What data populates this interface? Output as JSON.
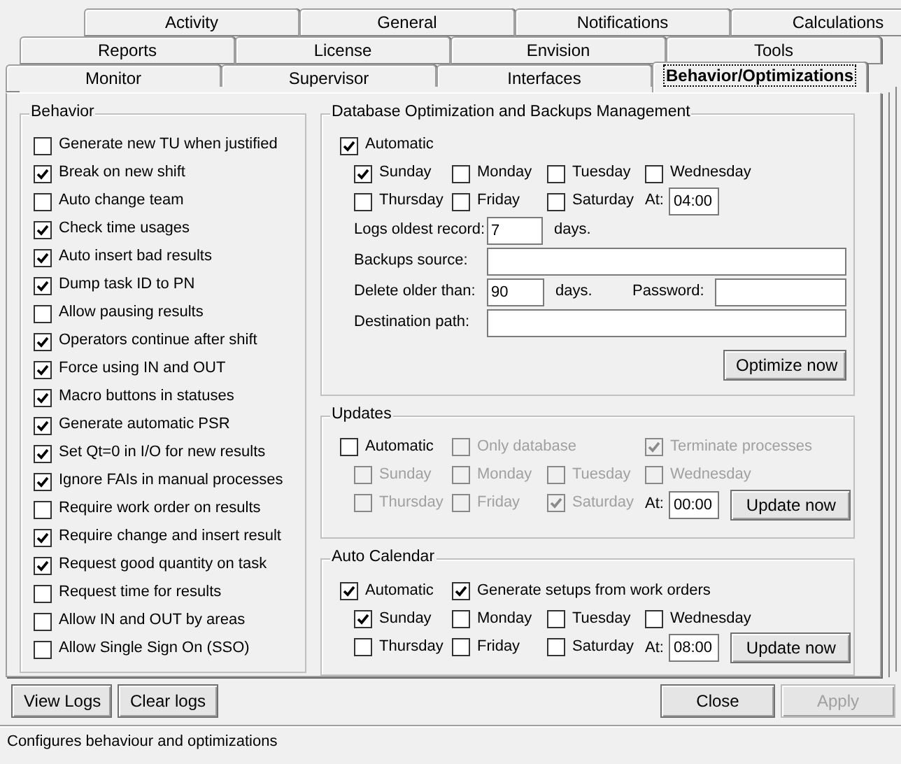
{
  "tab_rows": [
    {
      "tabs": [
        {
          "label": "Activity",
          "selected": false
        },
        {
          "label": "General",
          "selected": false
        },
        {
          "label": "Notifications",
          "selected": false
        },
        {
          "label": "Calculations",
          "selected": false
        }
      ]
    },
    {
      "tabs": [
        {
          "label": "Reports",
          "selected": false
        },
        {
          "label": "License",
          "selected": false
        },
        {
          "label": "Envision",
          "selected": false
        },
        {
          "label": "Tools",
          "selected": false
        }
      ]
    },
    {
      "tabs": [
        {
          "label": "Monitor",
          "selected": false
        },
        {
          "label": "Supervisor",
          "selected": false
        },
        {
          "label": "Interfaces",
          "selected": false
        },
        {
          "label": "Behavior/Optimizations",
          "selected": true
        }
      ]
    }
  ],
  "behavior": {
    "title": "Behavior",
    "items": [
      {
        "label": "Generate new TU when justified",
        "checked": false
      },
      {
        "label": "Break on new shift",
        "checked": true
      },
      {
        "label": "Auto change team",
        "checked": false
      },
      {
        "label": "Check time usages",
        "checked": true
      },
      {
        "label": "Auto insert bad results",
        "checked": true
      },
      {
        "label": "Dump task ID to PN",
        "checked": true
      },
      {
        "label": "Allow pausing results",
        "checked": false
      },
      {
        "label": "Operators continue after shift",
        "checked": true
      },
      {
        "label": "Force using IN and OUT",
        "checked": true
      },
      {
        "label": "Macro buttons in statuses",
        "checked": true
      },
      {
        "label": "Generate automatic PSR",
        "checked": true
      },
      {
        "label": "Set Qt=0 in I/O for new results",
        "checked": true
      },
      {
        "label": "Ignore FAIs in manual processes",
        "checked": true
      },
      {
        "label": "Require work order on results",
        "checked": false
      },
      {
        "label": "Require change and insert result",
        "checked": true
      },
      {
        "label": "Request good quantity on task",
        "checked": true
      },
      {
        "label": "Request time for results",
        "checked": false
      },
      {
        "label": "Allow IN and OUT by areas",
        "checked": false
      },
      {
        "label": "Allow Single Sign On (SSO)",
        "checked": false
      }
    ]
  },
  "database": {
    "title": "Database Optimization and Backups Management",
    "options": [
      {
        "label": "Automatic",
        "checked": true,
        "disabled": false
      }
    ],
    "days": [
      {
        "label": "Sunday",
        "checked": true,
        "disabled": false
      },
      {
        "label": "Monday",
        "checked": false,
        "disabled": false
      },
      {
        "label": "Tuesday",
        "checked": false,
        "disabled": false
      },
      {
        "label": "Wednesday",
        "checked": false,
        "disabled": false
      },
      {
        "label": "Thursday",
        "checked": false,
        "disabled": false
      },
      {
        "label": "Friday",
        "checked": false,
        "disabled": false
      },
      {
        "label": "Saturday",
        "checked": false,
        "disabled": false
      }
    ],
    "at_label": "At:",
    "at_value": "04:00",
    "logs_label": "Logs oldest record:",
    "logs_value": "7",
    "logs_unit": "days.",
    "backups_label": "Backups source:",
    "delete_label": "Delete older than:",
    "delete_value": "90",
    "delete_unit": "days.",
    "password_label": "Password:",
    "destination_label": "Destination path:",
    "button": "Optimize now"
  },
  "updates": {
    "title": "Updates",
    "options": [
      {
        "label": "Automatic",
        "checked": false,
        "disabled": false
      },
      {
        "label": "Only database",
        "checked": false,
        "disabled": true
      },
      {
        "label": "Terminate processes",
        "checked": true,
        "disabled": true
      }
    ],
    "days": [
      {
        "label": "Sunday",
        "checked": false,
        "disabled": true
      },
      {
        "label": "Monday",
        "checked": false,
        "disabled": true
      },
      {
        "label": "Tuesday",
        "checked": false,
        "disabled": true
      },
      {
        "label": "Wednesday",
        "checked": false,
        "disabled": true
      },
      {
        "label": "Thursday",
        "checked": false,
        "disabled": true
      },
      {
        "label": "Friday",
        "checked": false,
        "disabled": true
      },
      {
        "label": "Saturday",
        "checked": true,
        "disabled": true
      }
    ],
    "at_label": "At:",
    "at_value": "00:00",
    "button": "Update now"
  },
  "auto_calendar": {
    "title": "Auto Calendar",
    "options": [
      {
        "label": "Automatic",
        "checked": true,
        "disabled": false
      },
      {
        "label": "Generate setups from work orders",
        "checked": true,
        "disabled": false
      }
    ],
    "days": [
      {
        "label": "Sunday",
        "checked": true,
        "disabled": false
      },
      {
        "label": "Monday",
        "checked": false,
        "disabled": false
      },
      {
        "label": "Tuesday",
        "checked": false,
        "disabled": false
      },
      {
        "label": "Wednesday",
        "checked": false,
        "disabled": false
      },
      {
        "label": "Thursday",
        "checked": false,
        "disabled": false
      },
      {
        "label": "Friday",
        "checked": false,
        "disabled": false
      },
      {
        "label": "Saturday",
        "checked": false,
        "disabled": false
      }
    ],
    "at_label": "At:",
    "at_value": "08:00",
    "button": "Update now"
  },
  "footer_left": [
    {
      "label": "View Logs",
      "disabled": false
    },
    {
      "label": "Clear logs",
      "disabled": false
    }
  ],
  "footer_right": [
    {
      "label": "Close",
      "disabled": false
    },
    {
      "label": "Apply",
      "disabled": true
    }
  ],
  "status_bar": "Configures behaviour and optimizations"
}
